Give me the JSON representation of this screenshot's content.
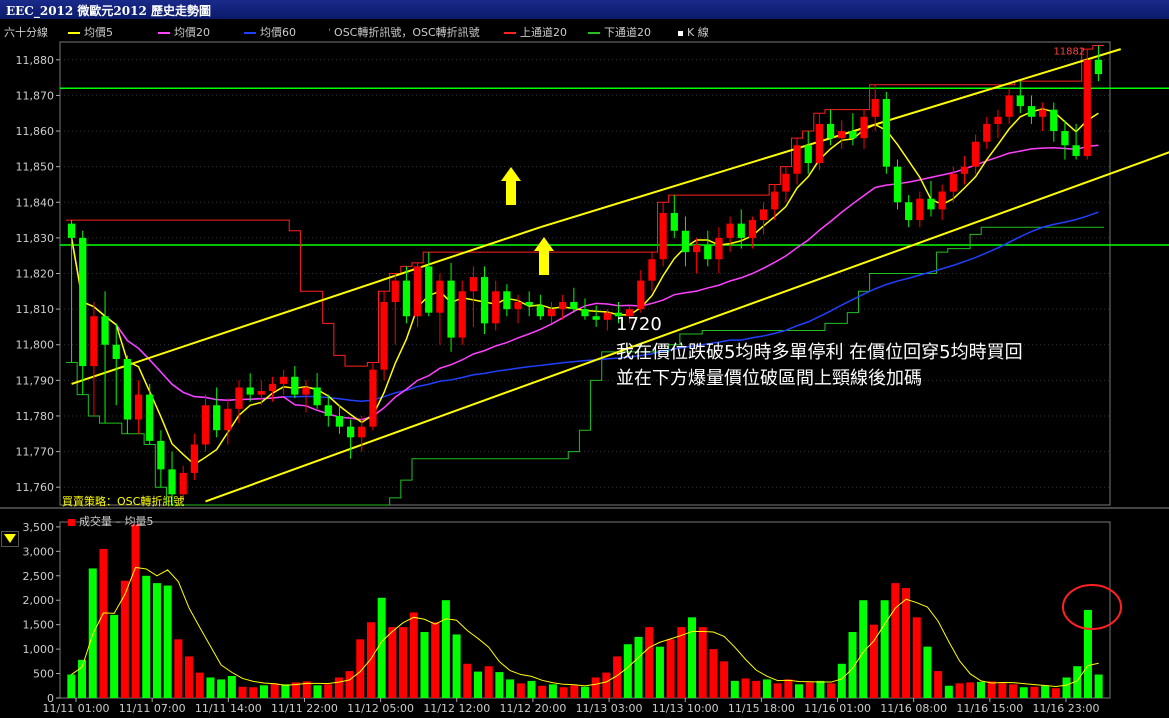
{
  "window": {
    "title": "EEC_2012 微歐元2012  歷史走勢圖"
  },
  "legend": {
    "period": "六十分線",
    "items": [
      {
        "label": "均價5",
        "color": "#ffff00",
        "kind": "line"
      },
      {
        "label": "均價20",
        "color": "#ff40ff",
        "kind": "line"
      },
      {
        "label": "均價60",
        "color": "#2040ff",
        "kind": "line"
      },
      {
        "label": "OSC轉折訊號，OSC轉折訊號",
        "color": "#ff4040",
        "kind": "dot"
      },
      {
        "label": "上通道20",
        "color": "#ff2020",
        "kind": "line"
      },
      {
        "label": "下通道20",
        "color": "#20c020",
        "kind": "line"
      },
      {
        "label": "K 線",
        "color": "#ffffff",
        "kind": "square"
      }
    ]
  },
  "strategy_label": "買賣策略：OSC轉折訊號",
  "volume_legend": {
    "vol": "成交量",
    "sep": "–",
    "avg": "均量5"
  },
  "annotation": {
    "time": "1720",
    "line1": "我在價位跌破5均時多單停利  在價位回穿5均時買回",
    "line2": "並在下方爆量價位破區間上頸線後加碼"
  },
  "colors": {
    "up": "#ff0000",
    "down": "#00ff00",
    "ma5": "#ffff00",
    "ma20": "#ff40ff",
    "ma60": "#2040ff",
    "upper": "#ff2020",
    "lower": "#20c020",
    "hline": "#00ff00",
    "channel": "#ffff00"
  },
  "chart_data": [
    {
      "type": "candlestick",
      "ylim": [
        11755,
        11885
      ],
      "y_ticks": [
        11760,
        11770,
        11780,
        11790,
        11800,
        11810,
        11820,
        11830,
        11840,
        11850,
        11860,
        11870,
        11880
      ],
      "last_price_label": "11882",
      "horizontal_lines": [
        11872,
        11828
      ],
      "channel_lines": [
        {
          "from": [
            0,
            11789
          ],
          "to": [
            42,
            11833
          ]
        },
        {
          "from": [
            42,
            11833
          ],
          "to": [
            94,
            11883
          ]
        },
        {
          "from": [
            12,
            11756
          ],
          "to": [
            108,
            11865
          ]
        }
      ],
      "candles": [
        [
          11834,
          11835,
          11795,
          11830
        ],
        [
          11830,
          11832,
          11786,
          11794
        ],
        [
          11794,
          11812,
          11780,
          11808
        ],
        [
          11808,
          11815,
          11778,
          11800
        ],
        [
          11800,
          11806,
          11783,
          11796
        ],
        [
          11796,
          11797,
          11775,
          11779
        ],
        [
          11779,
          11790,
          11775,
          11786
        ],
        [
          11786,
          11789,
          11772,
          11773
        ],
        [
          11773,
          11776,
          11760,
          11765
        ],
        [
          11765,
          11770,
          11755,
          11758
        ],
        [
          11758,
          11766,
          11757,
          11764
        ],
        [
          11764,
          11775,
          11762,
          11772
        ],
        [
          11772,
          11786,
          11770,
          11783
        ],
        [
          11783,
          11788,
          11774,
          11776
        ],
        [
          11776,
          11785,
          11772,
          11782
        ],
        [
          11782,
          11790,
          11778,
          11788
        ],
        [
          11788,
          11792,
          11784,
          11786
        ],
        [
          11786,
          11790,
          11783,
          11787
        ],
        [
          11787,
          11791,
          11784,
          11789
        ],
        [
          11789,
          11793,
          11786,
          11791
        ],
        [
          11791,
          11794,
          11785,
          11786
        ],
        [
          11786,
          11790,
          11781,
          11788
        ],
        [
          11788,
          11792,
          11782,
          11783
        ],
        [
          11783,
          11786,
          11777,
          11780
        ],
        [
          11780,
          11783,
          11775,
          11777
        ],
        [
          11777,
          11779,
          11768,
          11774
        ],
        [
          11774,
          11780,
          11770,
          11777
        ],
        [
          11777,
          11795,
          11776,
          11793
        ],
        [
          11793,
          11815,
          11790,
          11812
        ],
        [
          11812,
          11820,
          11800,
          11818
        ],
        [
          11818,
          11822,
          11806,
          11808
        ],
        [
          11808,
          11823,
          11805,
          11822
        ],
        [
          11822,
          11826,
          11808,
          11809
        ],
        [
          11809,
          11820,
          11800,
          11818
        ],
        [
          11818,
          11823,
          11798,
          11802
        ],
        [
          11802,
          11818,
          11800,
          11815
        ],
        [
          11815,
          11822,
          11805,
          11819
        ],
        [
          11819,
          11822,
          11803,
          11806
        ],
        [
          11806,
          11818,
          11804,
          11815
        ],
        [
          11815,
          11817,
          11808,
          11810
        ],
        [
          11810,
          11814,
          11806,
          11812
        ],
        [
          11812,
          11815,
          11808,
          11811
        ],
        [
          11811,
          11814,
          11807,
          11808
        ],
        [
          11808,
          11812,
          11806,
          11810
        ],
        [
          11810,
          11814,
          11807,
          11812
        ],
        [
          11812,
          11816,
          11809,
          11810
        ],
        [
          11810,
          11813,
          11807,
          11808
        ],
        [
          11808,
          11811,
          11805,
          11807
        ],
        [
          11807,
          11810,
          11804,
          11809
        ],
        [
          11809,
          11812,
          11806,
          11808
        ],
        [
          11808,
          11811,
          11806,
          11810
        ],
        [
          11810,
          11821,
          11809,
          11818
        ],
        [
          11818,
          11826,
          11815,
          11824
        ],
        [
          11824,
          11840,
          11822,
          11837
        ],
        [
          11837,
          11842,
          11830,
          11832
        ],
        [
          11832,
          11836,
          11822,
          11826
        ],
        [
          11826,
          11830,
          11820,
          11828
        ],
        [
          11828,
          11832,
          11822,
          11824
        ],
        [
          11824,
          11833,
          11820,
          11830
        ],
        [
          11830,
          11836,
          11826,
          11834
        ],
        [
          11834,
          11838,
          11827,
          11830
        ],
        [
          11830,
          11836,
          11827,
          11835
        ],
        [
          11835,
          11840,
          11831,
          11838
        ],
        [
          11838,
          11845,
          11835,
          11843
        ],
        [
          11843,
          11850,
          11840,
          11848
        ],
        [
          11848,
          11858,
          11845,
          11856
        ],
        [
          11856,
          11860,
          11848,
          11851
        ],
        [
          11851,
          11865,
          11849,
          11862
        ],
        [
          11862,
          11866,
          11856,
          11858
        ],
        [
          11858,
          11863,
          11855,
          11860
        ],
        [
          11860,
          11865,
          11856,
          11858
        ],
        [
          11858,
          11866,
          11855,
          11864
        ],
        [
          11864,
          11873,
          11860,
          11869
        ],
        [
          11869,
          11871,
          11848,
          11850
        ],
        [
          11850,
          11852,
          11838,
          11840
        ],
        [
          11840,
          11842,
          11833,
          11835
        ],
        [
          11835,
          11843,
          11833,
          11841
        ],
        [
          11841,
          11846,
          11836,
          11838
        ],
        [
          11838,
          11845,
          11835,
          11843
        ],
        [
          11843,
          11850,
          11840,
          11848
        ],
        [
          11848,
          11853,
          11845,
          11850
        ],
        [
          11850,
          11859,
          11848,
          11857
        ],
        [
          11857,
          11864,
          11855,
          11862
        ],
        [
          11862,
          11866,
          11858,
          11864
        ],
        [
          11864,
          11872,
          11862,
          11870
        ],
        [
          11870,
          11874,
          11865,
          11867
        ],
        [
          11867,
          11870,
          11862,
          11864
        ],
        [
          11864,
          11868,
          11860,
          11866
        ],
        [
          11866,
          11868,
          11857,
          11860
        ],
        [
          11860,
          11863,
          11852,
          11856
        ],
        [
          11856,
          11862,
          11852,
          11853
        ],
        [
          11853,
          11883,
          11852,
          11880
        ],
        [
          11880,
          11884,
          11874,
          11876
        ]
      ]
    },
    {
      "type": "bar",
      "series_name": "成交量",
      "avg_name": "均量5",
      "ylim": [
        0,
        3600
      ],
      "y_ticks": [
        0,
        500,
        1000,
        1500,
        2000,
        2500,
        3000,
        3500
      ],
      "x_tick_labels": [
        "11/11 01:00",
        "11/11 07:00",
        "11/11 14:00",
        "11/11 22:00",
        "11/12 05:00",
        "11/12 12:00",
        "11/12 20:00",
        "11/13 03:00",
        "11/13 10:00",
        "11/15 18:00",
        "11/16 01:00",
        "11/16 08:00",
        "11/16 15:00",
        "11/16 23:00"
      ],
      "values": [
        480,
        780,
        2650,
        3050,
        1700,
        2400,
        3550,
        2500,
        2350,
        2300,
        1200,
        850,
        520,
        420,
        380,
        450,
        230,
        220,
        260,
        300,
        280,
        320,
        340,
        260,
        280,
        420,
        550,
        1200,
        1550,
        2050,
        1450,
        1450,
        1750,
        1350,
        1550,
        2000,
        1300,
        700,
        540,
        650,
        530,
        380,
        300,
        350,
        250,
        280,
        220,
        260,
        230,
        420,
        520,
        850,
        1100,
        1250,
        1450,
        1050,
        1200,
        1450,
        1650,
        1450,
        1000,
        750,
        350,
        400,
        350,
        380,
        300,
        380,
        280,
        320,
        350,
        300,
        700,
        1350,
        2000,
        1500,
        2000,
        2350,
        2250,
        1650,
        1050,
        550,
        250,
        300,
        320,
        330,
        340,
        300,
        280,
        220,
        230,
        250,
        200,
        420,
        650,
        1800,
        480
      ],
      "colors": "gggrgrrgggrrrgggrrgrgrrgrrrrrgrrrgrggrgrggrgrgrrgrrrggrgrrgrrrgrrgrrgrgrgggrgrrrgrgrrgrrrgrgrg"
    }
  ]
}
